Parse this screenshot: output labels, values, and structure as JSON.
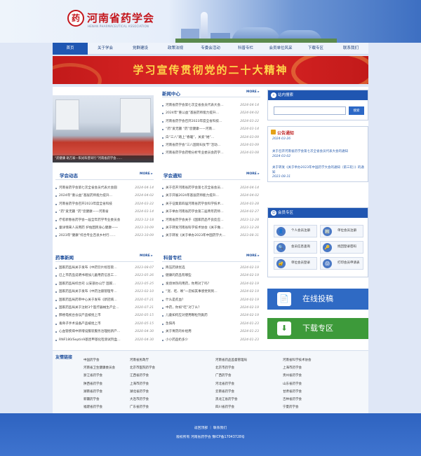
{
  "header": {
    "logo_char": "药",
    "title": "河南省药学会",
    "subtitle_en": "HENAN PHARMACEUTICAL ASSOCIATION"
  },
  "nav": [
    "首页",
    "关于学会",
    "党群建设",
    "政策法规",
    "专委会活动",
    "科普专栏",
    "会员单位风采",
    "下载专区",
    "联系我们"
  ],
  "banner": {
    "text": "学习宣传贯彻党的二十大精神"
  },
  "photo": {
    "caption": "“药健康 助万家—阳光科普同行”河南省药学会……"
  },
  "news_center": {
    "title": "新闻中心",
    "more": "MORE",
    "items": [
      {
        "t": "河南省药学会第七次全省会员代表大会…",
        "d": "2024-04-14"
      },
      {
        "t": "2024年“重公益”基层药师能力提升…",
        "d": "2024-04-02"
      },
      {
        "t": "河南省药学会召开2023年度全省科技…",
        "d": "2024-03-22"
      },
      {
        "t": "“药”爱无疆 “药”您健康——河南…",
        "d": "2024-03-14"
      },
      {
        "t": "白“三八”踏上“春暖”，关爱“她”…",
        "d": "2024-03-09"
      },
      {
        "t": "河南省药学会“三八国际妇女节”活动…",
        "d": "2024-03-09"
      },
      {
        "t": "河南省药学会药物分析专业委员会药学…",
        "d": "2024-03-08"
      }
    ]
  },
  "search": {
    "title": "站内搜索",
    "placeholder": "",
    "button": "搜索"
  },
  "notice": {
    "title": "公告通知",
    "items": [
      {
        "t": "",
        "d": "2024-03-26"
      },
      {
        "t": "关于召开河南省药学会第七次全省会员代表大会的通知",
        "d": "2024-03-02"
      },
      {
        "t": "关于转发《关于举办2023年中国药学大会的通知（第三轮）》的通知",
        "d": "2023-08-31"
      }
    ]
  },
  "assoc_news": {
    "title": "学会动态",
    "more": "MORE",
    "items": [
      {
        "t": "河南省药学会第七次全省会员代表大会圆",
        "d": "2024-04-14"
      },
      {
        "t": "2024年“重公益”基层药师能力提升…",
        "d": "2024-04-02"
      },
      {
        "t": "河南省药学会召开2023年度全省科技",
        "d": "2024-03-22"
      },
      {
        "t": "“药”爱无疆 “药”您健康——河南省",
        "d": "2024-03-14"
      },
      {
        "t": "疗愈新春省药学会一届全年药学专业委员会",
        "d": "2023-12-18"
      },
      {
        "t": "童详情来人员用药 护佑困民身心健康——",
        "d": "2023-10-09"
      },
      {
        "t": "2023年“健康”综合专业百县乡村行……",
        "d": "2023-10-09"
      }
    ]
  },
  "assoc_notice": {
    "title": "学会通知",
    "more": "MORE",
    "items": [
      {
        "t": "关于召开河南省药学会第七次全省会员…",
        "d": "2024-04-14"
      },
      {
        "t": "关于开展2024年基层药师能力提升…",
        "d": "2024-04-02"
      },
      {
        "t": "关于征集第四届河南省药学会科学技术…",
        "d": "2024-03-28"
      },
      {
        "t": "关于举办河南省药学会第二届青年药师…",
        "d": "2024-02-27"
      },
      {
        "t": "河南省药学会关于《国家药品不良反应…",
        "d": "2023-12-28"
      },
      {
        "t": "关于转发河南省科学技术协会《关于做…",
        "d": "2023-12-28"
      },
      {
        "t": "关于转发《关于举办2023年中国药学大…",
        "d": "2023-08-31"
      }
    ]
  },
  "member": {
    "title": "会员专区",
    "buttons": [
      {
        "label": "个人会员注册",
        "icon": "👤"
      },
      {
        "label": "单位会员注册",
        "icon": "🏢"
      },
      {
        "label": "会员信息查询",
        "icon": "🔍"
      },
      {
        "label": "找回登录密码",
        "icon": "🔑"
      },
      {
        "label": "单位会员登录",
        "icon": "🔐"
      },
      {
        "label": "打印会员申请表",
        "icon": "🖨"
      }
    ]
  },
  "pharma_news": {
    "title": "药事新闻",
    "more": "MORE",
    "items": [
      {
        "t": "国家药监局关于发布《中药饮片标签管…",
        "d": "2023-08-07"
      },
      {
        "t": "已上市药品说明书增加儿童用药信息工…",
        "d": "2023-05-26"
      },
      {
        "t": "国家药监局综合司 公安部办公厅 国家…",
        "d": "2023-05-25"
      },
      {
        "t": "国家药监局关于发布《中药注册管理专…",
        "d": "2023-02-10"
      },
      {
        "t": "国家药监局药审中心关于发布《新冠病…",
        "d": "2020-07-21"
      },
      {
        "t": "国家药监局关于注射3个医疗器械生产企…",
        "d": "2020-07-21"
      },
      {
        "t": "肺癌电视台会议产品被批上市",
        "d": "2020-05-15"
      },
      {
        "t": "毒骨子手术设备产品被批上市",
        "d": "2020-05-15"
      },
      {
        "t": "心血管疾病中新增设服装服务治理批新产…",
        "d": "2020-04-30"
      },
      {
        "t": "RNF180/Septin9基因甲基化检测试剂盒…",
        "d": "2020-04-30"
      }
    ]
  },
  "science": {
    "title": "科普专栏",
    "more": "MORE",
    "items": [
      {
        "t": "降压药请优选",
        "d": "2024-02-19"
      },
      {
        "t": "健康的药品有哪些",
        "d": "2024-02-19"
      },
      {
        "t": "发烧体热的用药，你用对了吗？",
        "d": "2024-02-19"
      },
      {
        "t": "“宠、吃、唤”一忽如其事感觉到到…",
        "d": "2024-02-19"
      },
      {
        "t": "什么是贫血？",
        "d": "2024-02-19"
      },
      {
        "t": "中药，你如“吃”对了么？",
        "d": "2024-02-19"
      },
      {
        "t": "儿童如何应对使用颗粒剂类药",
        "d": "2024-02-19"
      },
      {
        "t": "急阳丹",
        "d": "2024-01-23"
      },
      {
        "t": "关于胃药的补给用",
        "d": "2024-01-23"
      },
      {
        "t": "小小药品奶多少",
        "d": "2024-01-23"
      }
    ]
  },
  "online_submit": {
    "label": "在线投稿",
    "icon": "📄"
  },
  "download": {
    "label": "下载专区",
    "icon": "⬇"
  },
  "links": {
    "title": "友情链接",
    "items": [
      "中国药学会",
      "河南省民政厅",
      "河南省药品监督管理局",
      "河南省科学技术协会",
      "河南省卫生健康委员会",
      "北京市医院药学会",
      "北京市药学会",
      "上海市药学会",
      "浙江省药学会",
      "江西省药学会",
      "广西药学会",
      "贵州省药学会",
      "陕西省药学会",
      "上海市药学会",
      "河北省药学会",
      "山东省药学会",
      "湖南省药学会",
      "湖北省药学会",
      "云南省药学会",
      "甘肃省药学会",
      "新疆药学会",
      "大连市药学会",
      "黑龙江省药学会",
      "吉林省药学会",
      "福建省药学会",
      "广东省药学会",
      "四川省药学会",
      "宁夏药学会"
    ]
  },
  "footer": {
    "line1": "返回顶部 ｜ 联系我们",
    "line2": "版权所有 河南省药学会 豫ICP备17043728号"
  }
}
